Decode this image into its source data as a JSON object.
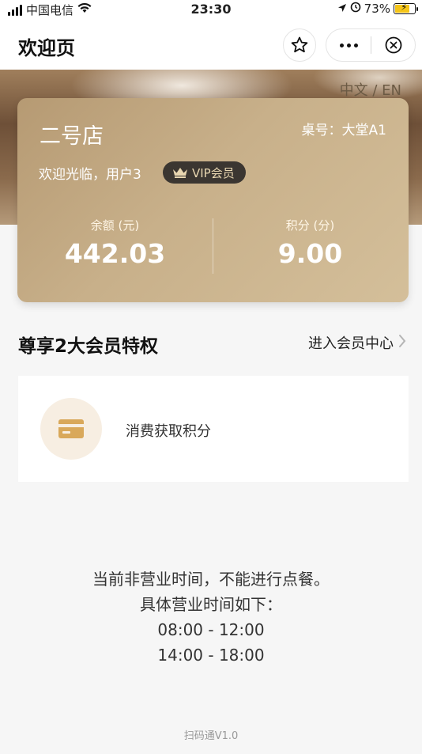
{
  "status_bar": {
    "carrier": "中国电信",
    "time": "23:30",
    "battery": "73%",
    "icons": [
      "signal-icon",
      "wifi-icon",
      "location-icon",
      "alarm-icon",
      "battery-icon"
    ]
  },
  "nav": {
    "title": "欢迎页",
    "icons": [
      "star-icon",
      "more-icon",
      "close-circle-icon"
    ]
  },
  "banner": {
    "lang_toggle": "中文 / EN"
  },
  "card": {
    "store_name": "二号店",
    "table": "桌号：大堂A1",
    "welcome": "欢迎光临，用户3",
    "vip_label": "VIP会员",
    "balance_label": "余额 (元)",
    "balance_value": "442.03",
    "points_label": "积分 (分)",
    "points_value": "9.00"
  },
  "section": {
    "title": "尊享2大会员特权",
    "link": "进入会员中心"
  },
  "privileges": [
    {
      "icon": "card-icon",
      "label": "消费获取积分"
    }
  ],
  "notice": {
    "line1": "当前非营业时间，不能进行点餐。",
    "line2": "具体营业时间如下：",
    "hours1": "08:00 - 12:00",
    "hours2": "14:00 - 18:00"
  },
  "footer": "扫码通V1.0",
  "colors": {
    "card_gold": "#c8b08a",
    "vip_badge_bg": "#3b3631",
    "icon_gold": "#d9a85a",
    "page_bg": "#f6f6f6"
  }
}
